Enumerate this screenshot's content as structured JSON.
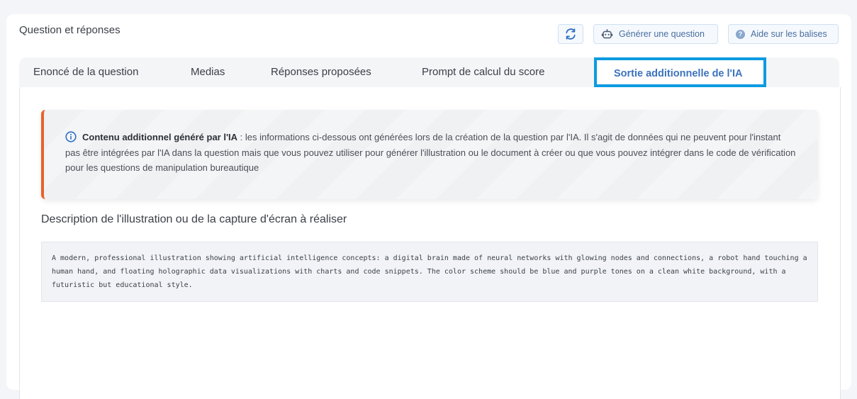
{
  "card": {
    "title": "Question et réponses"
  },
  "toolbar": {
    "refresh_icon": "refresh-icon",
    "generate_label": "Générer une question",
    "generate_icon": "robot-icon",
    "help_label": "Aide sur les balises",
    "help_icon": "question-icon"
  },
  "tabs": [
    {
      "label": "Enoncé de la question"
    },
    {
      "label": "Medias"
    },
    {
      "label": "Réponses proposées"
    },
    {
      "label": "Prompt de calcul du score"
    },
    {
      "label": "Sortie additionnelle de l'IA",
      "active": true
    }
  ],
  "alert": {
    "icon": "info-icon",
    "title": "Contenu additionnel généré par l'IA",
    "text": " : les informations ci-dessous ont générées lors de la création de la question par l'IA. Il s'agit de données qui ne peuvent pour l'instant pas être intégrées par l'IA dans la question mais que vous pouvez utiliser pour générer l'illustration ou le document à créer ou que vous pouvez intégrer dans le code de vérification pour les questions de manipulation bureautique",
    "accent_color": "#e8612c"
  },
  "section": {
    "title": "Description de l'illustration ou de la capture d'écran à réaliser",
    "description": "A modern, professional illustration showing artificial intelligence concepts: a digital brain made of neural networks with glowing nodes and connections, a robot hand touching a human hand, and floating holographic data visualizations with charts and code snippets. The color scheme should be blue and purple tones on a clean white background, with a futuristic but educational style."
  },
  "colors": {
    "active_tab_border": "#0c9be0",
    "active_tab_text": "#3c73bd"
  }
}
